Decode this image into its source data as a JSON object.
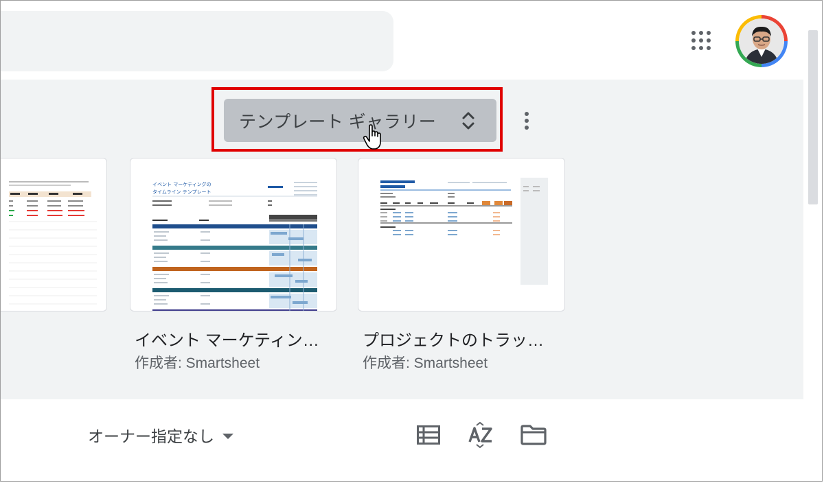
{
  "gallery": {
    "button_label": "テンプレート ギャラリー",
    "templates": [
      {
        "title": "イベント マーケティン…",
        "author": "作成者: Smartsheet",
        "thumb_heading": "イベント マーケティングの タイムライン テンプレート"
      },
      {
        "title": "プロジェクトのトラッ…",
        "author": "作成者: Smartsheet"
      }
    ]
  },
  "toolbar": {
    "owner_filter": "オーナー指定なし"
  },
  "icons": {
    "apps": "apps-grid-icon",
    "more": "more-vert-icon",
    "list_view": "list-view-icon",
    "sort": "sort-az-icon",
    "folder": "folder-icon",
    "gallery_toggle": "unfold-icon"
  },
  "colors": {
    "highlight": "#e00000",
    "gallery_bg": "#f1f3f4",
    "button_bg": "#bdc1c6"
  }
}
